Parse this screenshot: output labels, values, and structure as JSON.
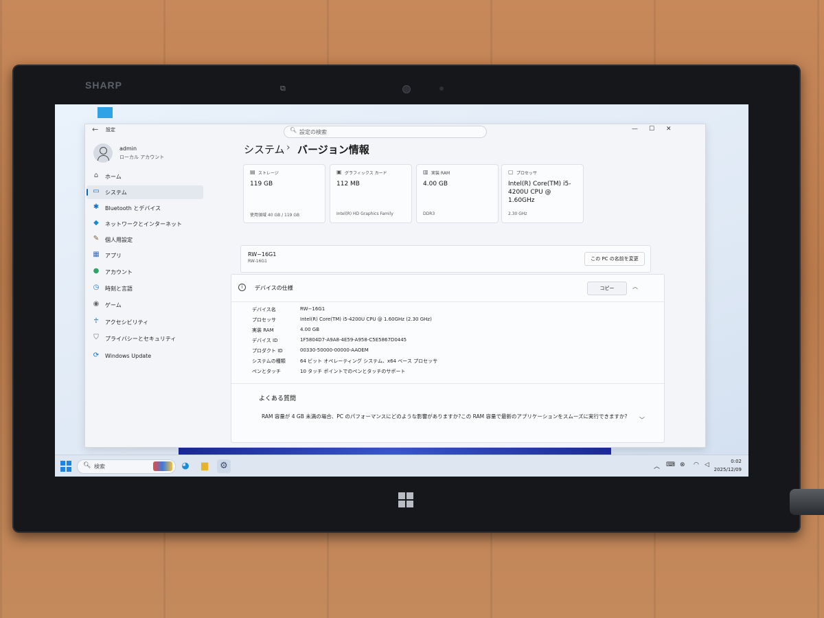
{
  "bezel": {
    "brand": "SHARP"
  },
  "titlebar": {
    "title": "設定",
    "search_placeholder": "設定の検索"
  },
  "user": {
    "name": "admin",
    "type": "ローカル アカウント"
  },
  "nav": [
    {
      "label": "ホーム",
      "icon": "home-icon",
      "glyph": "⌂",
      "color": "#555555"
    },
    {
      "label": "システム",
      "icon": "system-icon",
      "glyph": "▭",
      "color": "#0067c0",
      "selected": true
    },
    {
      "label": "Bluetooth とデバイス",
      "icon": "bluetooth-icon",
      "glyph": "✱",
      "color": "#0a6fd0"
    },
    {
      "label": "ネットワークとインターネット",
      "icon": "network-icon",
      "glyph": "◆",
      "color": "#1787d6"
    },
    {
      "label": "個人用設定",
      "icon": "brush-icon",
      "glyph": "✎",
      "color": "#7a5a3a"
    },
    {
      "label": "アプリ",
      "icon": "apps-icon",
      "glyph": "▦",
      "color": "#3b6fb5"
    },
    {
      "label": "アカウント",
      "icon": "account-icon",
      "glyph": "●",
      "color": "#2fa36a"
    },
    {
      "label": "時刻と言語",
      "icon": "clock-icon",
      "glyph": "◷",
      "color": "#1a73c9"
    },
    {
      "label": "ゲーム",
      "icon": "game-icon",
      "glyph": "◉",
      "color": "#666666"
    },
    {
      "label": "アクセシビリティ",
      "icon": "accessibility-icon",
      "glyph": "☥",
      "color": "#1b68b8"
    },
    {
      "label": "プライバシーとセキュリティ",
      "icon": "shield-icon",
      "glyph": "⛉",
      "color": "#666666"
    },
    {
      "label": "Windows Update",
      "icon": "update-icon",
      "glyph": "⟳",
      "color": "#0a73cf"
    }
  ],
  "breadcrumb": {
    "parent": "システム",
    "separator": "›",
    "current": "バージョン情報"
  },
  "cards": [
    {
      "label": "ストレージ",
      "value": "119 GB",
      "sub": "使用領域 40 GB / 119 GB",
      "icon": "storage-icon"
    },
    {
      "label": "グラフィックス カード",
      "value": "112 MB",
      "sub": "Intel(R) HD Graphics Family",
      "icon": "gpu-icon"
    },
    {
      "label": "実装 RAM",
      "value": "4.00 GB",
      "sub": "DDR3",
      "icon": "ram-icon"
    },
    {
      "label": "プロセッサ",
      "value": "Intel(R) Core(TM) i5-4200U CPU @ 1.60GHz",
      "sub": "2.30 GHz",
      "icon": "cpu-icon"
    }
  ],
  "pc": {
    "name": "RW−16G1",
    "model": "RW-16G1",
    "rename_label": "この PC の名前を変更"
  },
  "specs": {
    "title": "デバイスの仕様",
    "copy_label": "コピー",
    "rows": [
      {
        "key": "デバイス名",
        "value": "RW−16G1"
      },
      {
        "key": "プロセッサ",
        "value": "Intel(R) Core(TM) i5-4200U CPU @ 1.60GHz (2.30 GHz)"
      },
      {
        "key": "実装 RAM",
        "value": "4.00 GB"
      },
      {
        "key": "デバイス ID",
        "value": "1F5804D7-A9A8-4E59-A958-C5E5867D0445"
      },
      {
        "key": "プロダクト ID",
        "value": "00330-50000-00000-AAOEM"
      },
      {
        "key": "システムの種類",
        "value": "64 ビット オペレーティング システム、x64 ベース プロセッサ"
      },
      {
        "key": "ペンとタッチ",
        "value": "10 タッチ ポイントでのペンとタッチのサポート"
      }
    ]
  },
  "faq": {
    "title": "よくある質問",
    "question": "RAM 容量が 4 GB 未満の場合、PC のパフォーマンスにどのような影響がありますか?この RAM 容量で最新のアプリケーションをスムーズに実行できますか?"
  },
  "taskbar": {
    "search_placeholder": "検索",
    "time": "0:02",
    "date": "2025/12/09"
  }
}
